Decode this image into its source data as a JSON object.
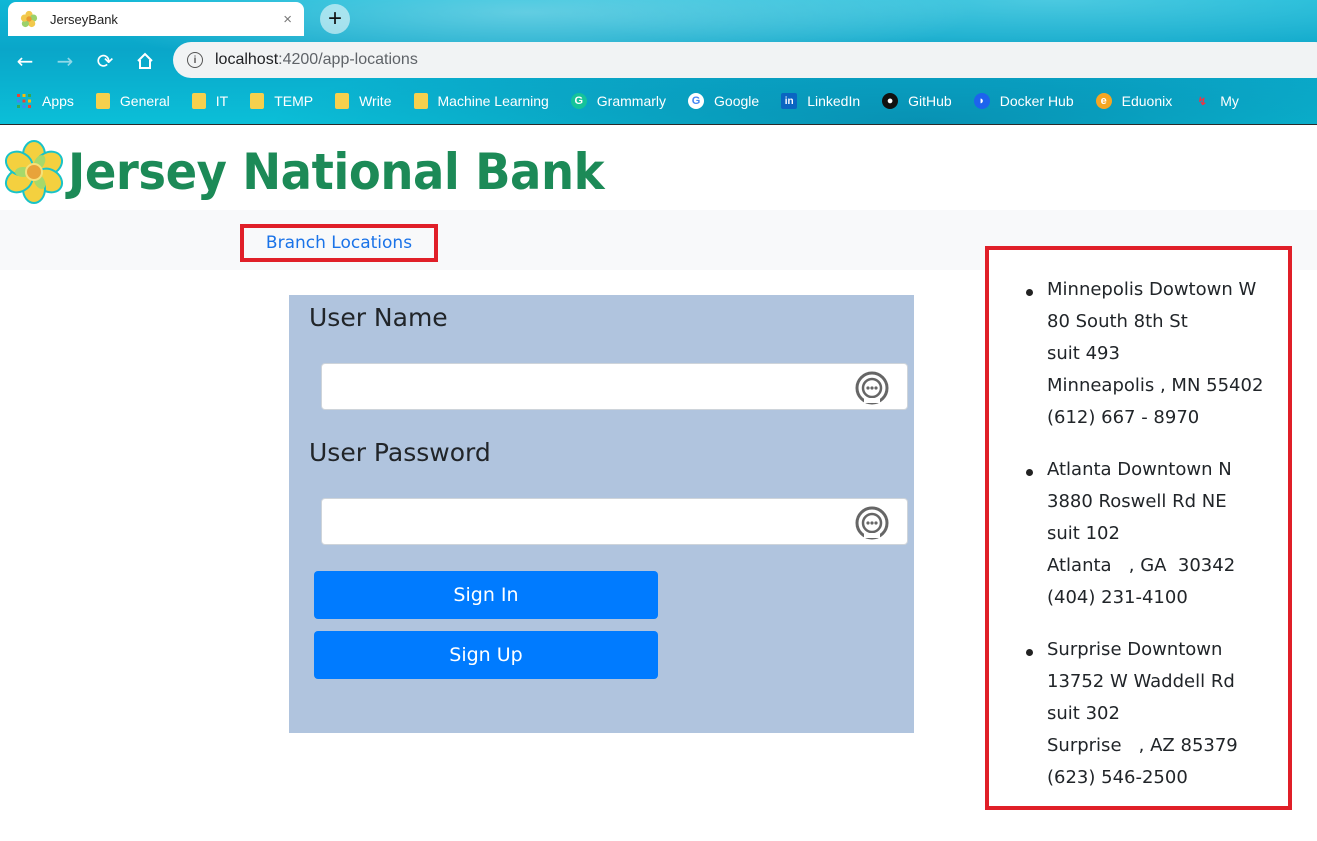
{
  "browser": {
    "tab_title": "JerseyBank",
    "tab_close": "×",
    "new_tab": "+",
    "url_host": "localhost",
    "url_rest": ":4200/app-locations",
    "bookmarks": [
      {
        "label": "Apps",
        "icon": "apps-grid-icon"
      },
      {
        "label": "General",
        "icon": "folder-icon"
      },
      {
        "label": "IT",
        "icon": "folder-icon"
      },
      {
        "label": "TEMP",
        "icon": "folder-icon"
      },
      {
        "label": "Write",
        "icon": "folder-icon"
      },
      {
        "label": "Machine Learning",
        "icon": "folder-icon"
      },
      {
        "label": "Grammarly",
        "icon": "grammarly-icon"
      },
      {
        "label": "Google",
        "icon": "google-icon"
      },
      {
        "label": "LinkedIn",
        "icon": "linkedin-icon"
      },
      {
        "label": "GitHub",
        "icon": "github-icon"
      },
      {
        "label": "Docker Hub",
        "icon": "docker-icon"
      },
      {
        "label": "Eduonix",
        "icon": "eduonix-icon"
      },
      {
        "label": "My",
        "icon": "bookmark-icon"
      }
    ]
  },
  "header": {
    "title": "Jersey National Bank"
  },
  "navbar": {
    "branch_link": "Branch Locations"
  },
  "login": {
    "username_label": "User Name",
    "username_value": "",
    "password_label": "User Password",
    "password_value": "",
    "sign_in": "Sign In",
    "sign_up": "Sign Up"
  },
  "locations": [
    {
      "name": "Minnepolis Dowtown W",
      "street": "80 South 8th St",
      "suite": "suit 493",
      "city_line": "Minneapolis , MN 55402",
      "phone": "(612) 667 - 8970"
    },
    {
      "name": "Atlanta Downtown N",
      "street": "3880 Roswell Rd NE",
      "suite": "suit 102",
      "city_line": "Atlanta   , GA  30342",
      "phone": "(404) 231-4100"
    },
    {
      "name": "Surprise Downtown",
      "street": "13752 W Waddell Rd",
      "suite": "suit 302",
      "city_line": "Surprise   , AZ 85379",
      "phone": "(623) 546-2500"
    }
  ],
  "colors": {
    "brand_green": "#1c8a57",
    "highlight_red": "#e01f28",
    "button_blue": "#007bff",
    "panel_blue": "#b0c4de",
    "link_blue": "#1a73e8"
  }
}
